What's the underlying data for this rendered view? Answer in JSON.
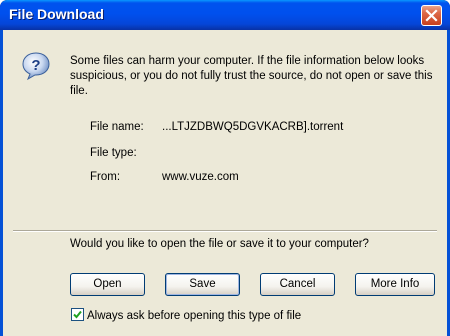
{
  "window": {
    "title": "File Download",
    "close_icon": "close-icon"
  },
  "dialog": {
    "icon": "question-icon",
    "warning": "Some files can harm your computer. If the file information below looks suspicious, or you do not fully trust the source, do not open or save this file.",
    "file_name_label": "File name:",
    "file_name_value": "...LTJZDBWQ5DGVKACRB].torrent",
    "file_type_label": "File type:",
    "file_type_value": "",
    "from_label": "From:",
    "from_value": "www.vuze.com",
    "question": "Would you like to open the file or save it to your computer?",
    "buttons": {
      "open": "Open",
      "save": "Save",
      "cancel": "Cancel",
      "more_info": "More Info"
    },
    "checkbox": {
      "label": "Always ask before opening this type of file",
      "checked": true
    }
  },
  "colors": {
    "titlebar": "#0053ee",
    "client": "#ece9d8",
    "close": "#c93f1c"
  }
}
